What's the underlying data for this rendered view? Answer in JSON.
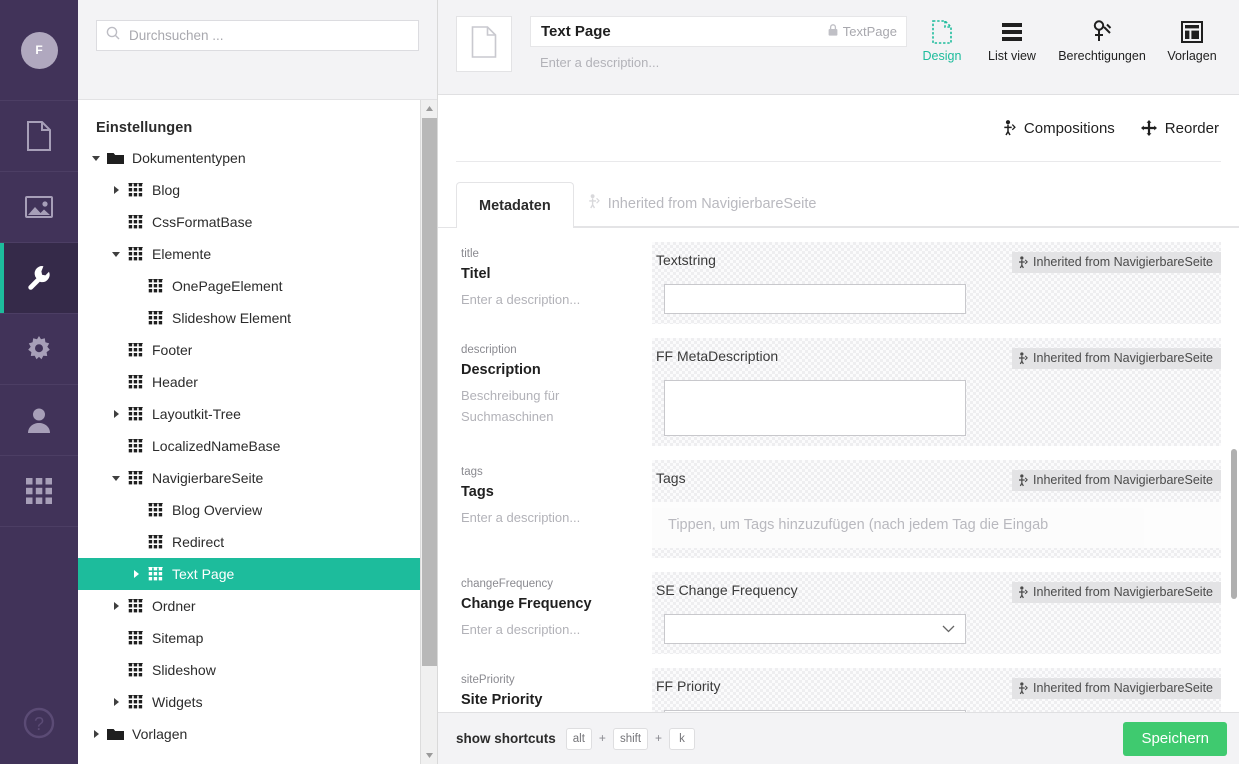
{
  "rail": {
    "avatar_initial": "F",
    "items": [
      {
        "icon": "content-document-icon",
        "name": "content",
        "active": false
      },
      {
        "icon": "media-image-icon",
        "name": "media",
        "active": false
      },
      {
        "icon": "settings-wrench-icon",
        "name": "settings",
        "active": true
      },
      {
        "icon": "gear-icon",
        "name": "configuration",
        "active": false
      },
      {
        "icon": "user-icon",
        "name": "users",
        "active": false
      },
      {
        "icon": "grid-apps-icon",
        "name": "apps",
        "active": false
      }
    ],
    "help_icon": "help-question-icon"
  },
  "search": {
    "placeholder": "Durchsuchen ...",
    "value": "",
    "icon": "search-icon"
  },
  "tree": {
    "title": "Einstellungen",
    "nodes": [
      {
        "label": "Dokumententypen",
        "depth": 0,
        "icon": "folder-icon",
        "caret": "down",
        "selected": false
      },
      {
        "label": "Blog",
        "depth": 1,
        "icon": "doctype-grid-icon",
        "caret": "right",
        "selected": false
      },
      {
        "label": "CssFormatBase",
        "depth": 1,
        "icon": "doctype-grid-icon",
        "caret": "none",
        "selected": false
      },
      {
        "label": "Elemente",
        "depth": 1,
        "icon": "doctype-grid-icon",
        "caret": "down",
        "selected": false
      },
      {
        "label": "OnePageElement",
        "depth": 2,
        "icon": "doctype-grid-icon",
        "caret": "none",
        "selected": false
      },
      {
        "label": "Slideshow Element",
        "depth": 2,
        "icon": "doctype-grid-icon",
        "caret": "none",
        "selected": false
      },
      {
        "label": "Footer",
        "depth": 1,
        "icon": "doctype-grid-icon",
        "caret": "none",
        "selected": false
      },
      {
        "label": "Header",
        "depth": 1,
        "icon": "doctype-grid-icon",
        "caret": "none",
        "selected": false
      },
      {
        "label": "Layoutkit-Tree",
        "depth": 1,
        "icon": "doctype-grid-icon",
        "caret": "right",
        "selected": false
      },
      {
        "label": "LocalizedNameBase",
        "depth": 1,
        "icon": "doctype-grid-icon",
        "caret": "none",
        "selected": false
      },
      {
        "label": "NavigierbareSeite",
        "depth": 1,
        "icon": "doctype-grid-icon",
        "caret": "down",
        "selected": false
      },
      {
        "label": "Blog Overview",
        "depth": 2,
        "icon": "doctype-grid-icon",
        "caret": "none",
        "selected": false
      },
      {
        "label": "Redirect",
        "depth": 2,
        "icon": "doctype-grid-icon",
        "caret": "none",
        "selected": false
      },
      {
        "label": "Text Page",
        "depth": 2,
        "icon": "doctype-grid-icon",
        "caret": "right",
        "selected": true
      },
      {
        "label": "Ordner",
        "depth": 1,
        "icon": "doctype-grid-icon",
        "caret": "right",
        "selected": false
      },
      {
        "label": "Sitemap",
        "depth": 1,
        "icon": "doctype-grid-icon",
        "caret": "none",
        "selected": false
      },
      {
        "label": "Slideshow",
        "depth": 1,
        "icon": "doctype-grid-icon",
        "caret": "none",
        "selected": false
      },
      {
        "label": "Widgets",
        "depth": 1,
        "icon": "doctype-grid-icon",
        "caret": "right",
        "selected": false
      },
      {
        "label": "Vorlagen",
        "depth": 0,
        "icon": "folder-icon",
        "caret": "right",
        "selected": false
      }
    ]
  },
  "header": {
    "thumb_icon": "document-icon",
    "name": "Text Page",
    "alias": "TextPage",
    "alias_icon": "lock-icon",
    "description_placeholder": "Enter a description...",
    "tabs": [
      {
        "label": "Design",
        "icon": "design-page-icon",
        "active": true
      },
      {
        "label": "List view",
        "icon": "list-view-icon",
        "active": false
      },
      {
        "label": "Berechtigungen",
        "icon": "permissions-key-icon",
        "active": false
      },
      {
        "label": "Vorlagen",
        "icon": "templates-icon",
        "active": false
      }
    ]
  },
  "subbar": {
    "compositions": {
      "label": "Compositions",
      "icon": "composition-icon"
    },
    "reorder": {
      "label": "Reorder",
      "icon": "move-cross-icon"
    }
  },
  "group_tabs": {
    "active": "Metadaten",
    "ghost": {
      "label": "Inherited from NavigierbareSeite",
      "icon": "composition-icon"
    }
  },
  "inherited_badge": {
    "label": "Inherited from NavigierbareSeite",
    "icon": "composition-icon"
  },
  "properties": [
    {
      "alias": "title",
      "name": "Titel",
      "description_placeholder": "Enter a description...",
      "editor_label": "Textstring",
      "inherited": "Inherited from NavigierbareSeite",
      "control": "textbox",
      "value": ""
    },
    {
      "alias": "description",
      "name": "Description",
      "description_placeholder": "Beschreibung für Suchmaschinen",
      "editor_label": "FF MetaDescription",
      "inherited": "Inherited from NavigierbareSeite",
      "control": "textarea",
      "value": ""
    },
    {
      "alias": "tags",
      "name": "Tags",
      "description_placeholder": "Enter a description...",
      "editor_label": "Tags",
      "inherited": "Inherited from NavigierbareSeite",
      "control": "tags",
      "value": "",
      "placeholder": "Tippen, um Tags hinzuzufügen (nach jedem Tag die Eingab"
    },
    {
      "alias": "changeFrequency",
      "name": "Change Frequency",
      "description_placeholder": "Enter a description...",
      "editor_label": "SE Change Frequency",
      "inherited": "Inherited from NavigierbareSeite",
      "control": "select",
      "value": ""
    },
    {
      "alias": "sitePriority",
      "name": "Site Priority",
      "description_placeholder": "",
      "editor_label": "FF Priority",
      "inherited": "Inherited from NavigierbareSeite",
      "control": "textbox",
      "value": ""
    }
  ],
  "footer": {
    "shortcuts_label": "show shortcuts",
    "keys": [
      "alt",
      "shift",
      "k"
    ],
    "separator": "+",
    "save_label": "Speichern"
  },
  "colors": {
    "rail_bg": "#413359",
    "accent_teal": "#1dbc9c",
    "save_green": "#3fca6f"
  }
}
